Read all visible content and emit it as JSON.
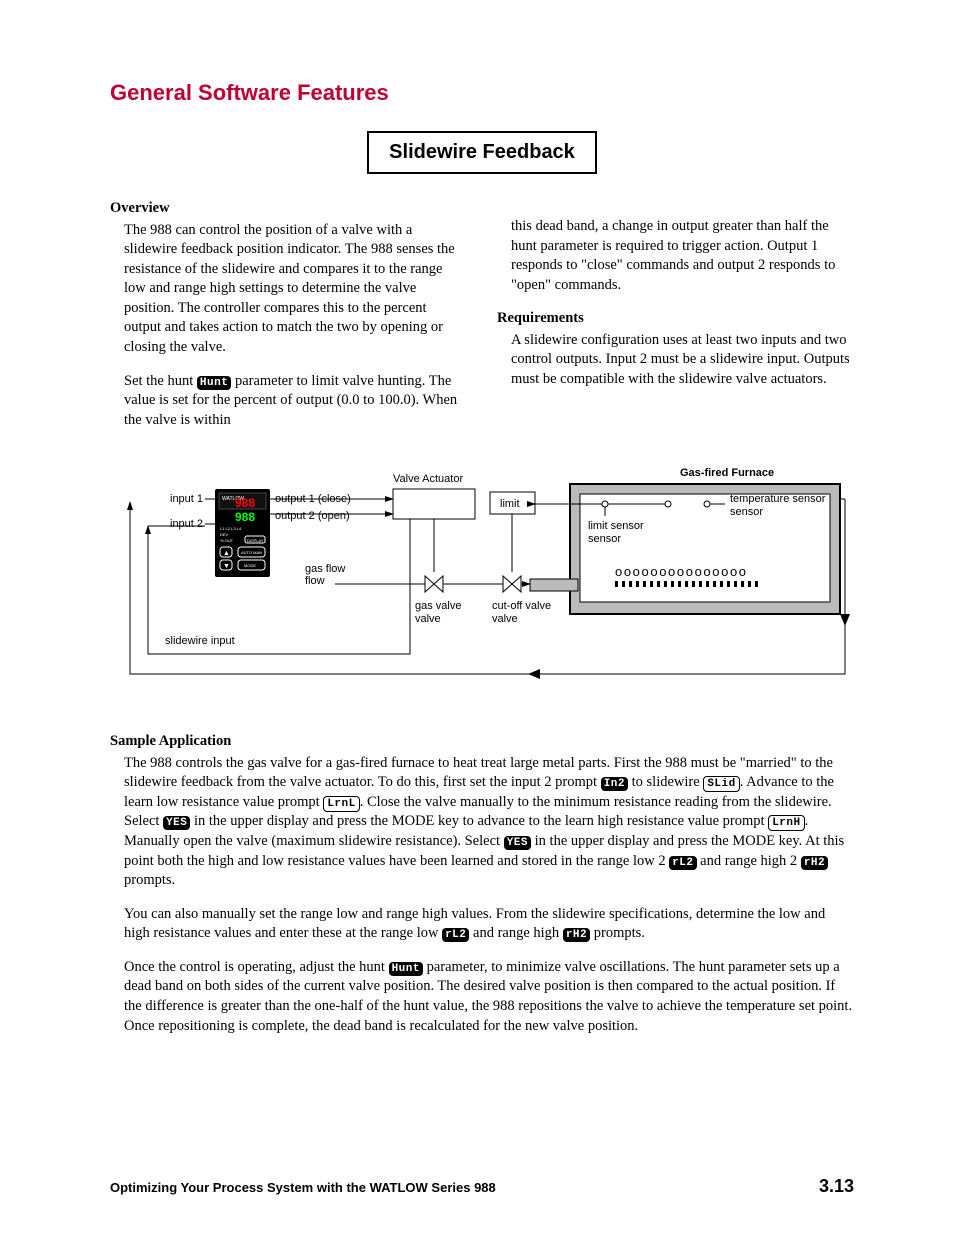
{
  "section_title": "General Software Features",
  "boxed_heading": "Slidewire Feedback",
  "overview": {
    "heading": "Overview",
    "p1": "The 988 can control the position of a valve with a slidewire feedback position indicator. The 988 senses the resistance of the slidewire and compares it to the range low and range high settings to determine the valve position. The controller compares this to the percent output and takes action to match the two by opening or closing the valve.",
    "p2a": "Set the hunt ",
    "p2b": " parameter to limit valve hunting. The value is set for the percent of output (0.0 to 100.0). When the valve is within",
    "p3": "this dead band, a change in output greater than half the hunt parameter is required to trigger action. Output 1 responds to \"close\" commands and output 2 responds to \"open\" commands."
  },
  "requirements": {
    "heading": "Requirements",
    "p1": "A slidewire configuration uses at least two inputs and two control outputs. Input 2 must be a slidewire input. Outputs must be compatible with the slidewire valve actuators."
  },
  "chips": {
    "hunt": "Hunt",
    "in2": "In2",
    "slid": "SLid",
    "lrnl": "LrnL",
    "yes": "YES",
    "lrnh": "LrnH",
    "rl2": "rL2",
    "rh2": "rH2"
  },
  "diagram": {
    "furnace_title": "Gas-fired Furnace",
    "labels": {
      "input1": "input 1",
      "input2": "input 2",
      "output1": "output 1 (close)",
      "output2": "output 2 (open)",
      "valve_actuator": "Valve Actuator",
      "gas_flow": "gas flow",
      "gas_valve": "gas valve",
      "cutoff_valve": "cut-off valve",
      "limit": "limit",
      "limit_sensor": "limit sensor",
      "temp_sensor": "temperature sensor",
      "slidewire_input": "slidewire input",
      "display_brand": "WATLOW",
      "display_val1": "988",
      "display_val2": "988",
      "display_row": "L1  L2  L3  L4",
      "display_row2": "DEV",
      "display_row3": "% OUT",
      "display_btn": "DISPLAY",
      "auto_man": "AUTO MAN",
      "mode": "MODE"
    }
  },
  "sample": {
    "heading": "Sample Application",
    "p1a": "The 988 controls the gas valve for a gas-fired furnace to heat treat large metal parts. First the 988 must be \"married\" to the slidewire feedback from the valve actuator. To do this, first set the input 2 prompt ",
    "p1b": " to slidewire ",
    "p1c": ". Advance to the learn low resistance value prompt ",
    "p1d": ". Close the valve manually to the minimum resistance reading from the slidewire. Select ",
    "p1e": " in the upper display and press the MODE key to advance to the learn high resistance value prompt ",
    "p1f": ". Manually open the valve (maximum slidewire resistance). Select ",
    "p1g": " in the upper display and press the MODE key. At this point both the high and low resistance values have been learned and stored in the range low 2 ",
    "p1h": " and range high 2 ",
    "p1i": " prompts.",
    "p2a": "You can also manually set the range low and range high values. From the slidewire specifications, determine the low and high resistance values and enter these at the range low ",
    "p2b": " and range high ",
    "p2c": " prompts.",
    "p3a": "Once the control is operating, adjust the hunt ",
    "p3b": " parameter, to minimize valve oscillations. The hunt parameter sets up a dead band on both sides of the current valve position. The desired valve position is then compared to the actual position. If the difference is greater than the one-half of the hunt value, the 988 repositions the valve to achieve the temperature set point. Once repositioning is complete, the dead band is recalculated for the new valve position."
  },
  "footer": {
    "left": "Optimizing Your Process System with the WATLOW Series 988",
    "right": "3.13"
  }
}
